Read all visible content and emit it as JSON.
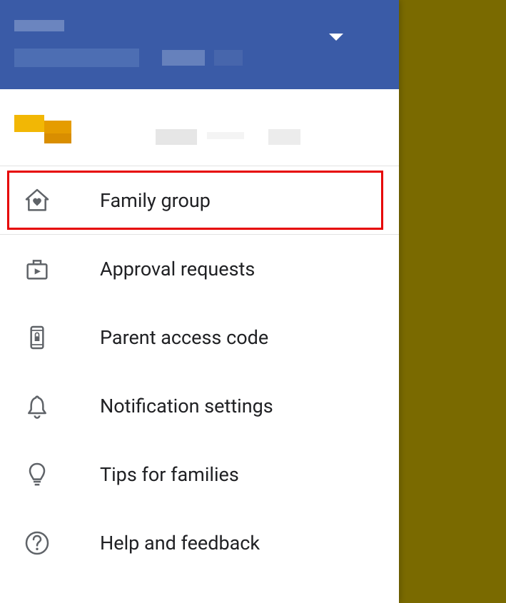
{
  "menu": {
    "items": [
      {
        "label": "Family group"
      },
      {
        "label": "Approval requests"
      },
      {
        "label": "Parent access code"
      },
      {
        "label": "Notification settings"
      },
      {
        "label": "Tips for families"
      },
      {
        "label": "Help and feedback"
      }
    ]
  }
}
